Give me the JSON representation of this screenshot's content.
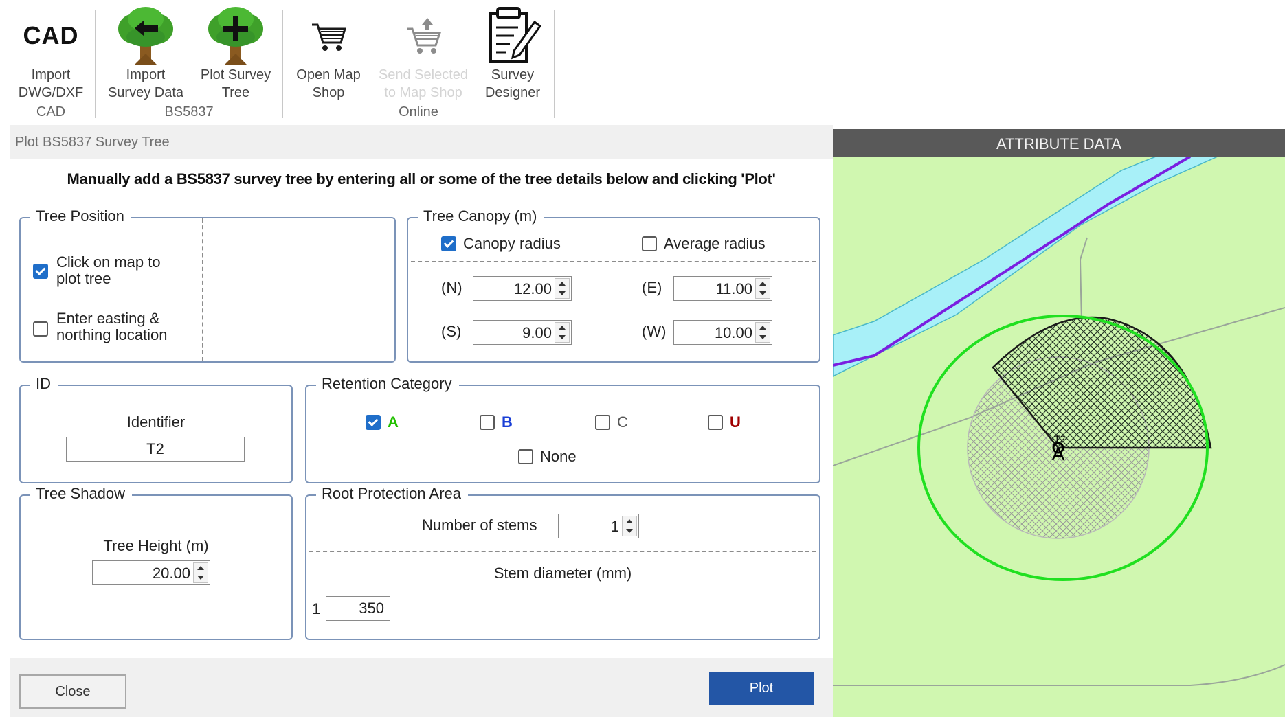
{
  "ribbon": {
    "cad_icon_text": "CAD",
    "buttons": [
      {
        "lines": [
          "Import",
          "DWG/DXF"
        ]
      },
      {
        "lines": [
          "Import",
          "Survey Data"
        ]
      },
      {
        "lines": [
          "Plot Survey",
          "Tree"
        ]
      },
      {
        "lines": [
          "Open Map",
          "Shop"
        ]
      },
      {
        "lines": [
          "Send Selected",
          "to Map Shop"
        ]
      },
      {
        "lines": [
          "Survey",
          "Designer"
        ]
      }
    ],
    "groups": {
      "cad": "CAD",
      "bs5837": "BS5837",
      "online": "Online"
    }
  },
  "dialog": {
    "title": "Plot BS5837 Survey Tree",
    "instruction": "Manually add a BS5837 survey tree by entering all or some of the tree details below and clicking 'Plot'",
    "tree_position": {
      "title": "Tree Position",
      "click_on_map": {
        "label_line1": "Click on map to",
        "label_line2": "plot tree",
        "checked": true
      },
      "enter_easting": {
        "label_line1": "Enter easting &",
        "label_line2": "northing location",
        "checked": false
      }
    },
    "tree_canopy": {
      "title": "Tree Canopy (m)",
      "canopy_radius": {
        "label": "Canopy radius",
        "checked": true
      },
      "average_radius": {
        "label": "Average radius",
        "checked": false
      },
      "n": {
        "label": "(N)",
        "value": "12.00"
      },
      "e": {
        "label": "(E)",
        "value": "11.00"
      },
      "s": {
        "label": "(S)",
        "value": "9.00"
      },
      "w": {
        "label": "(W)",
        "value": "10.00"
      }
    },
    "id": {
      "title": "ID",
      "identifier_label": "Identifier",
      "identifier_value": "T2"
    },
    "retention": {
      "title": "Retention Category",
      "options": [
        {
          "label": "A",
          "checked": true,
          "color": "#22c000"
        },
        {
          "label": "B",
          "checked": false,
          "color": "#1a3fd6"
        },
        {
          "label": "C",
          "checked": false,
          "color": "#555555"
        },
        {
          "label": "U",
          "checked": false,
          "color": "#a00000"
        }
      ],
      "none": {
        "label": "None",
        "checked": false
      }
    },
    "tree_shadow": {
      "title": "Tree Shadow",
      "height_label": "Tree Height (m)",
      "height_value": "20.00"
    },
    "rpa": {
      "title": "Root Protection Area",
      "stems_label": "Number of stems",
      "stems_value": "1",
      "diameter_label": "Stem diameter (mm)",
      "stem_index": "1",
      "stem_diameter": "350"
    },
    "close_label": "Close",
    "plot_label": "Plot"
  },
  "map": {
    "header": "ATTRIBUTE DATA",
    "tree_label": "T2",
    "colors": {
      "background": "#d0f7b0",
      "river": "#a8f0f8",
      "boundary": "#7a1fe0",
      "rpa_circle": "#20e020"
    }
  }
}
